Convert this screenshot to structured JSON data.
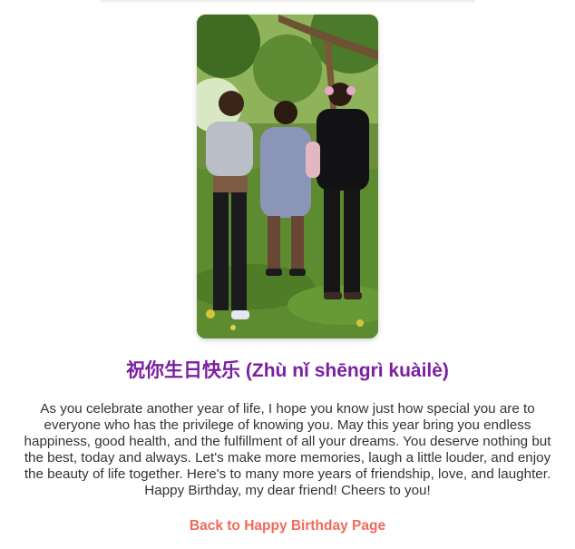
{
  "page": {
    "title": "祝你生日快乐 (Zhù nǐ shēngrì kuàilè)",
    "message": "As you celebrate another year of life, I hope you know just how special you are to everyone who has the privilege of knowing you. May this year bring you endless happiness, good health, and the fulfillment of all your dreams. You deserve nothing but the best, today and always. Let's make more memories, laugh a little louder, and enjoy the beauty of life together. Here's to many more years of friendship, love, and laughter. Happy Birthday, my dear friend! Cheers to you!",
    "back_link_label": "Back to Happy Birthday Page"
  },
  "colors": {
    "title": "#7b1fa2",
    "link": "#f06a5a",
    "text": "#333333"
  }
}
